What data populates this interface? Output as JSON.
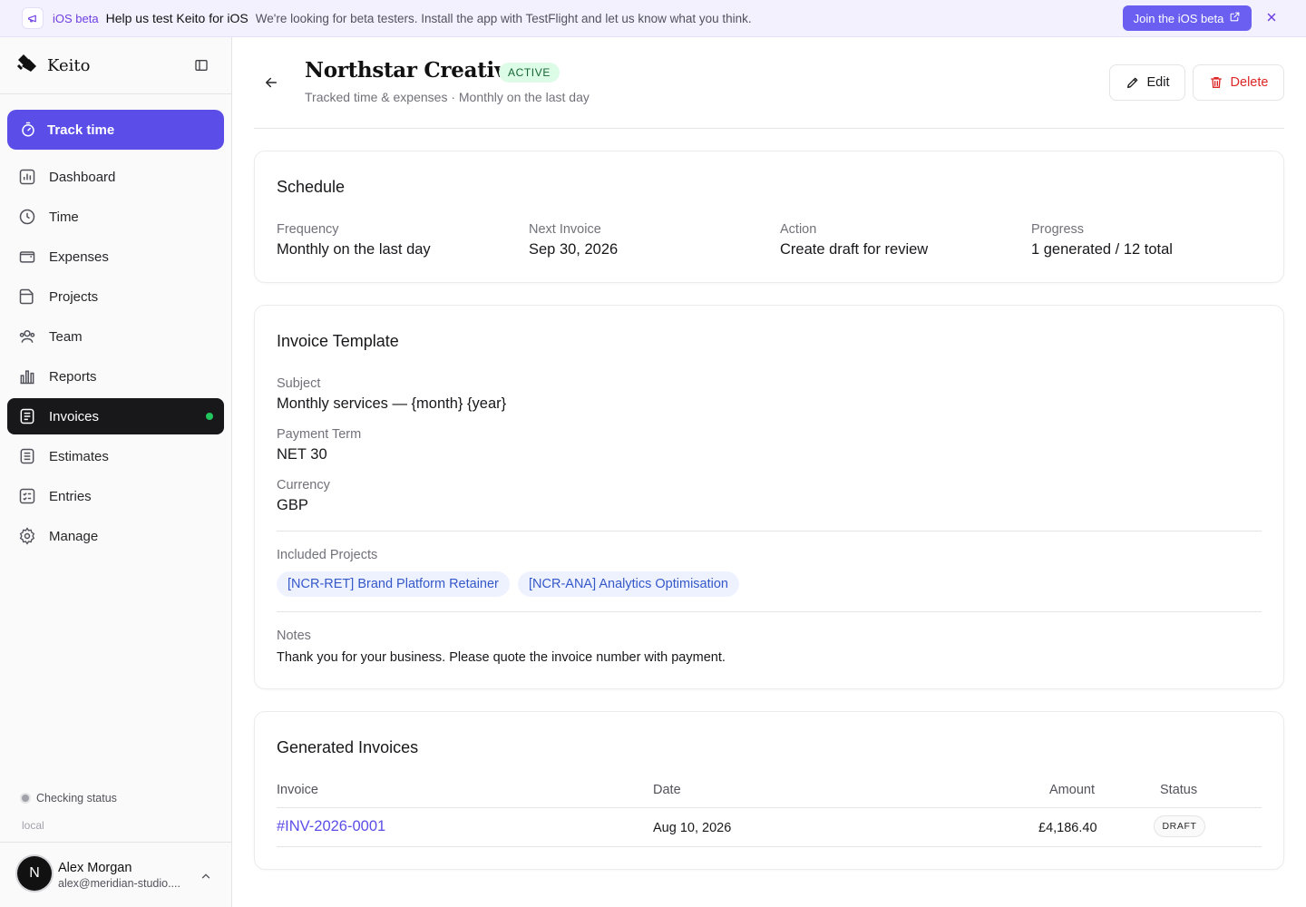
{
  "banner": {
    "tag": "iOS beta",
    "title": "Help us test Keito for iOS",
    "text": "We're looking for beta testers. Install the app with TestFlight and let us know what you think.",
    "button_label": "Join the iOS beta"
  },
  "sidebar": {
    "app_name": "Keito",
    "track_label": "Track time",
    "items": [
      {
        "label": "Dashboard",
        "icon": "chart-icon"
      },
      {
        "label": "Time",
        "icon": "clock-icon"
      },
      {
        "label": "Expenses",
        "icon": "wallet-icon"
      },
      {
        "label": "Projects",
        "icon": "folder-icon"
      },
      {
        "label": "Team",
        "icon": "team-icon"
      },
      {
        "label": "Reports",
        "icon": "bar-chart-icon"
      },
      {
        "label": "Invoices",
        "icon": "invoice-icon",
        "active": true
      },
      {
        "label": "Estimates",
        "icon": "list-icon"
      },
      {
        "label": "Entries",
        "icon": "entries-icon"
      },
      {
        "label": "Manage",
        "icon": "gear-icon"
      }
    ],
    "status": "Checking status",
    "env": "local",
    "user": {
      "initial": "N",
      "name": "Alex Morgan",
      "email": "alex@meridian-studio...."
    }
  },
  "header": {
    "title": "Northstar Creative",
    "status": "ACTIVE",
    "subtitle": "Tracked time & expenses · Monthly on the last day",
    "edit_label": "Edit",
    "delete_label": "Delete"
  },
  "schedule": {
    "title": "Schedule",
    "fields": [
      {
        "label": "Frequency",
        "value": "Monthly on the last day"
      },
      {
        "label": "Next Invoice",
        "value": "Sep 30, 2026"
      },
      {
        "label": "Action",
        "value": "Create draft for review"
      },
      {
        "label": "Progress",
        "value": "1 generated / 12 total"
      }
    ]
  },
  "template": {
    "title": "Invoice Template",
    "subject_label": "Subject",
    "subject_value": "Monthly services — {month} {year}",
    "term_label": "Payment Term",
    "term_value": "NET 30",
    "currency_label": "Currency",
    "currency_value": "GBP",
    "projects_label": "Included Projects",
    "projects": [
      "[NCR-RET] Brand Platform Retainer",
      "[NCR-ANA] Analytics Optimisation"
    ],
    "notes_label": "Notes",
    "notes_value": "Thank you for your business. Please quote the invoice number with payment."
  },
  "generated": {
    "title": "Generated Invoices",
    "columns": [
      "Invoice",
      "Date",
      "Amount",
      "Status"
    ],
    "rows": [
      {
        "invoice": "#INV-2026-0001",
        "date": "Aug 10, 2026",
        "amount": "£4,186.40",
        "status": "DRAFT"
      }
    ]
  },
  "colors": {
    "accent": "#5b4de8",
    "active_nav": "#18181b",
    "success": "#22c55e",
    "danger": "#dc2626"
  }
}
